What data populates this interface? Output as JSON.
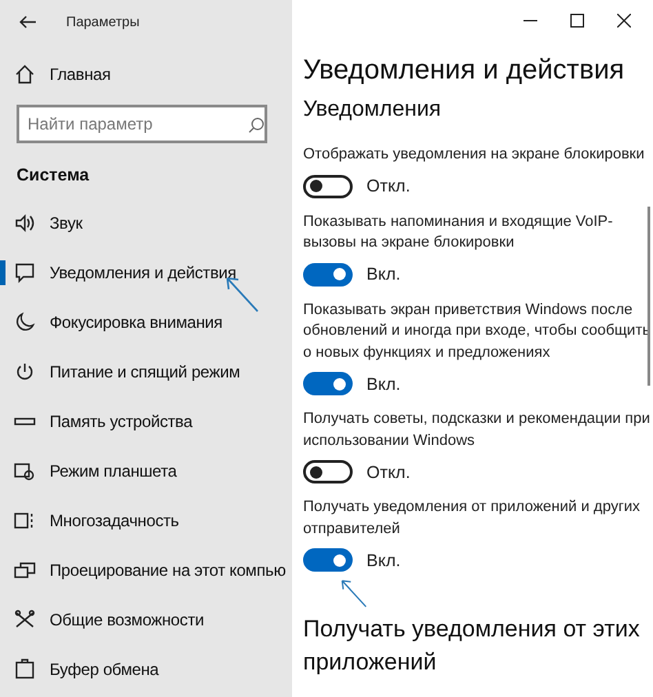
{
  "window": {
    "title": "Параметры"
  },
  "sidebar": {
    "home": "Главная",
    "search": {
      "placeholder": "Найти параметр"
    },
    "section": "Система",
    "items": [
      {
        "label": "Звук",
        "selected": false
      },
      {
        "label": "Уведомления и действия",
        "selected": true
      },
      {
        "label": "Фокусировка внимания",
        "selected": false
      },
      {
        "label": "Питание и спящий режим",
        "selected": false
      },
      {
        "label": "Память устройства",
        "selected": false
      },
      {
        "label": "Режим планшета",
        "selected": false
      },
      {
        "label": "Многозадачность",
        "selected": false
      },
      {
        "label": "Проецирование на этот компью",
        "selected": false
      },
      {
        "label": "Общие возможности",
        "selected": false
      },
      {
        "label": "Буфер обмена",
        "selected": false
      }
    ]
  },
  "main": {
    "title": "Уведомления и действия",
    "section": "Уведомления",
    "settings": [
      {
        "label": "Отображать уведомления на экране блокировки",
        "on": false,
        "state": "Откл."
      },
      {
        "label": "Показывать напоминания и входящие VoIP-вызовы на экране блокировки",
        "on": true,
        "state": "Вкл."
      },
      {
        "label": "Показывать экран приветствия Windows после обновлений и иногда при входе, чтобы сообщить о новых функциях и предложениях",
        "on": true,
        "state": "Вкл."
      },
      {
        "label": "Получать советы, подсказки и рекомендации при использовании Windows",
        "on": false,
        "state": "Откл."
      },
      {
        "label": "Получать уведомления от приложений и других отправителей",
        "on": true,
        "state": "Вкл."
      }
    ],
    "subheading": "Получать уведомления от этих приложений"
  }
}
